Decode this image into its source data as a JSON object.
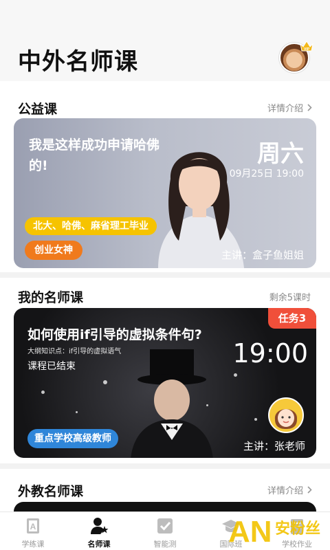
{
  "header": {
    "title": "中外名师课",
    "vip_label": "VIP"
  },
  "public_course": {
    "title": "公益课",
    "link_label": "详情介绍",
    "card": {
      "headline": "我是这样成功申请哈佛的!",
      "day": "周六",
      "datetime": "09月25日 19:00",
      "tag_education": "北大、哈佛、麻省理工毕业",
      "tag_title": "创业女神",
      "lecturer": "主讲：盒子鱼姐姐"
    }
  },
  "my_courses": {
    "title": "我的名师课",
    "remaining": "剩余5课时",
    "card": {
      "task_badge": "任务3",
      "title": "如何使用if引导的虚拟条件句?",
      "outline": "大纲知识点：if引导的虚拟语气",
      "status": "课程已结束",
      "time": "19:00",
      "tag": "重点学校高级教师",
      "lecturer": "主讲：张老师"
    }
  },
  "foreign_courses": {
    "title": "外教名师课",
    "link_label": "详情介绍"
  },
  "tabbar": {
    "items": [
      {
        "label": "学练课",
        "active": false,
        "icon": "book-a-icon"
      },
      {
        "label": "名师课",
        "active": true,
        "icon": "teacher-star-icon"
      },
      {
        "label": "智能测",
        "active": false,
        "icon": "check-icon"
      },
      {
        "label": "国际班",
        "active": false,
        "icon": "graduation-cap-icon"
      },
      {
        "label": "学校作业",
        "active": false,
        "icon": "homework-icon"
      }
    ]
  },
  "watermark": {
    "text": "AN 安粉丝"
  },
  "colors": {
    "accent_yellow": "#f6c300",
    "accent_orange": "#f07a1c",
    "task_red": "#f04f3a",
    "tag_blue": "#2f86d9"
  }
}
